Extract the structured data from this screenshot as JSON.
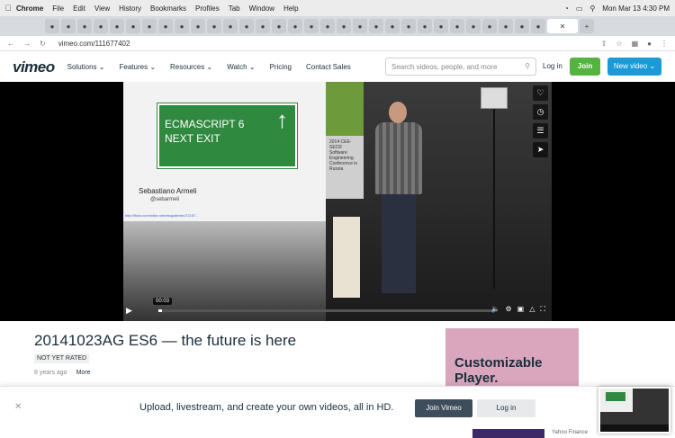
{
  "mac_menu": {
    "app": "Chrome",
    "items": [
      "File",
      "Edit",
      "View",
      "History",
      "Bookmarks",
      "Profiles",
      "Tab",
      "Window",
      "Help"
    ],
    "datetime": "Mon Mar 13  4:30 PM"
  },
  "browser": {
    "url": "vimeo.com/111677402"
  },
  "vimeo": {
    "logo": "vimeo",
    "nav": [
      "Solutions",
      "Features",
      "Resources",
      "Watch",
      "Pricing",
      "Contact Sales"
    ],
    "search_placeholder": "Search videos, people, and more",
    "login": "Log in",
    "join": "Join",
    "new_video": "New video"
  },
  "video": {
    "slide_sign_line1": "ECMASCRIPT 6",
    "slide_sign_line2": "NEXT EXIT",
    "slide_author": "Sebastiano Armeli",
    "slide_handle": "@sebarmeli",
    "slide_credit": "http://flickr.com/mike-roberts/galleries/72157...",
    "poster_text": "2014 CEE-SECR Software Engineering Conference in Russia",
    "timestamp": "00:03",
    "progress_fraction": 0.01
  },
  "page": {
    "title": "20141023AG ES6 — the future is here",
    "rating": "NOT YET RATED",
    "age": "8 years ago",
    "more": "More"
  },
  "ad": {
    "line1": "Customizable",
    "line2": "Player."
  },
  "banner": {
    "message": "Upload, livestream, and create your own videos, all in HD.",
    "join": "Join Vimeo",
    "login": "Log in"
  },
  "footer": {
    "yahoo": "Yahoo Finance"
  },
  "colors": {
    "join_green": "#55b33f",
    "new_video_blue": "#1a9bd7",
    "sign_green": "#2f8a3f",
    "ad_pink": "#d9a6bd",
    "join_vimeo_dark": "#3d4d5b"
  }
}
